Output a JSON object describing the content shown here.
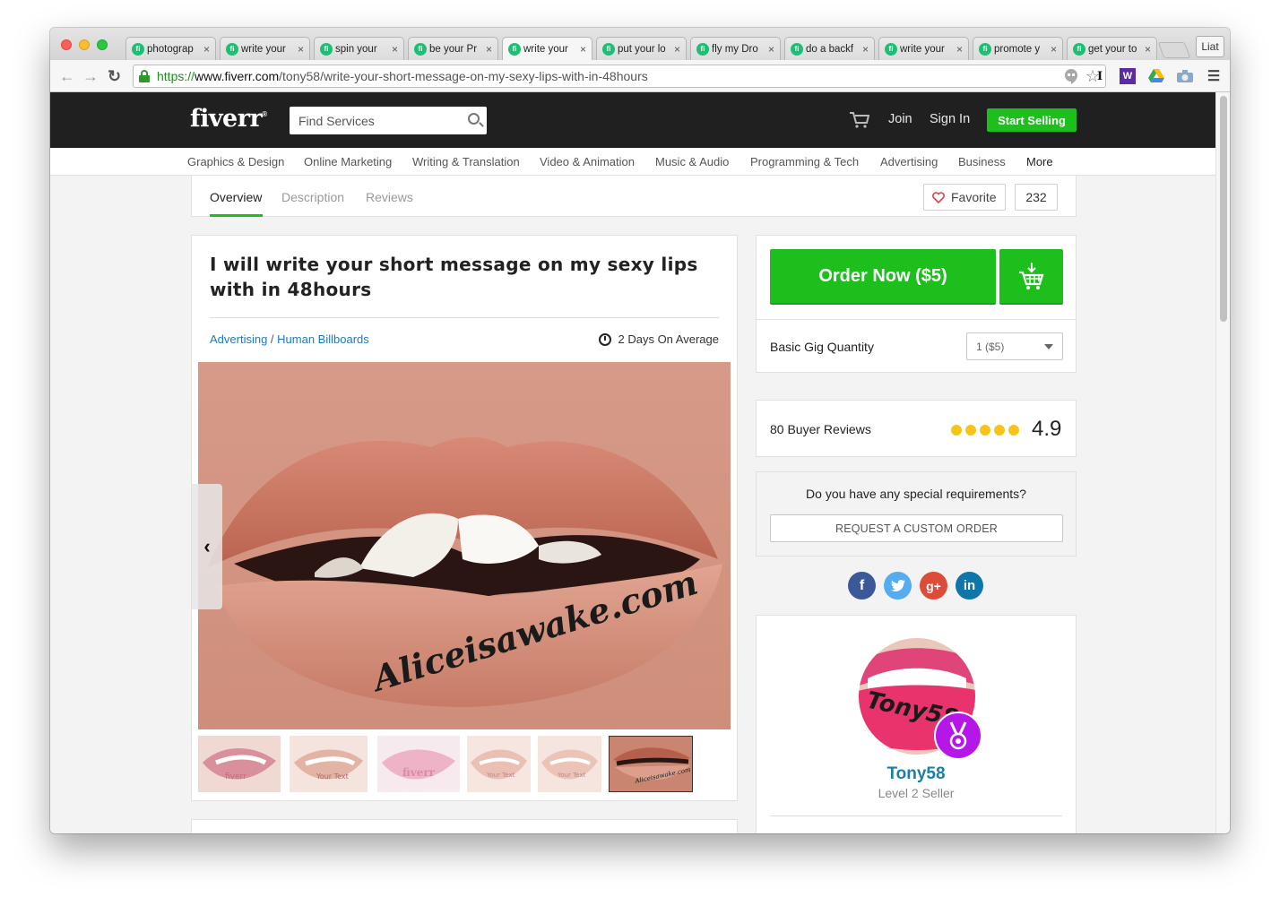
{
  "browser": {
    "tabs": [
      {
        "label": "photograp",
        "active": false
      },
      {
        "label": "write your",
        "active": false
      },
      {
        "label": "spin your",
        "active": false
      },
      {
        "label": "be your Pr",
        "active": false
      },
      {
        "label": "write your",
        "active": true
      },
      {
        "label": "put your lo",
        "active": false
      },
      {
        "label": "fly my Dro",
        "active": false
      },
      {
        "label": "do a backf",
        "active": false
      },
      {
        "label": "write your",
        "active": false
      },
      {
        "label": "promote y",
        "active": false
      },
      {
        "label": "get your to",
        "active": false
      }
    ],
    "favicon_text": "fi",
    "profile_name": "Liat",
    "url": {
      "scheme": "https://",
      "host": "www.fiverr.com",
      "path": "/tony58/write-your-short-message-on-my-sexy-lips-with-in-48hours"
    },
    "extension_letter": "I"
  },
  "header": {
    "logo": "fiverr",
    "logo_mark": "®",
    "search_placeholder": "Find Services",
    "join": "Join",
    "sign_in": "Sign In",
    "start_selling": "Start Selling"
  },
  "categories": [
    "Graphics & Design",
    "Online Marketing",
    "Writing & Translation",
    "Video & Animation",
    "Music & Audio",
    "Programming & Tech",
    "Advertising",
    "Business",
    "More"
  ],
  "subnav": {
    "tabs": [
      "Overview",
      "Description",
      "Reviews"
    ],
    "active_tab": "Overview",
    "favorite_label": "Favorite",
    "favorite_count": "232"
  },
  "gig": {
    "title": "I will write your short message on my sexy lips with in 48hours",
    "breadcrumb": {
      "category": "Advertising",
      "separator": " / ",
      "subcategory": "Human Billboards"
    },
    "delivery": "2 Days On Average",
    "image_text": "Aliceisawake.com",
    "thumbnail_texts": [
      "fiverr",
      "Your Text",
      "fiverr",
      "Your Text",
      "Your Text",
      "Aliceisawake.com"
    ]
  },
  "order": {
    "order_now": "Order Now ($5)",
    "quantity_label": "Basic Gig Quantity",
    "quantity_value": "1 ($5)"
  },
  "reviews": {
    "label": "80 Buyer Reviews",
    "rating": "4.9",
    "stars": 5
  },
  "custom_order": {
    "question": "Do you have any special requirements?",
    "button": "REQUEST A CUSTOM ORDER"
  },
  "social": [
    "facebook",
    "twitter",
    "google-plus",
    "linkedin"
  ],
  "seller": {
    "name": "Tony58",
    "level": "Level 2 Seller",
    "avatar_text": "Tony58"
  },
  "colors": {
    "brand_green": "#1dbf1d",
    "header_dark": "#202020",
    "link_blue": "#1e7bb8",
    "badge_purple": "#b517e8",
    "star_yellow": "#f5c518"
  }
}
